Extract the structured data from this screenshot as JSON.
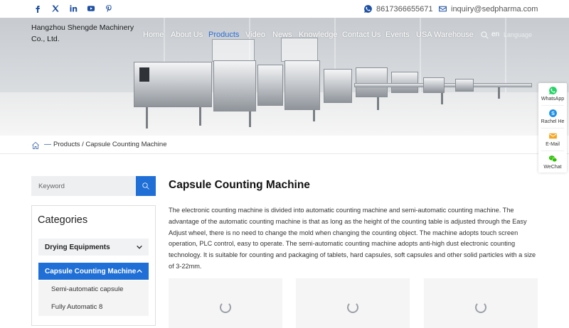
{
  "topbar": {
    "social_icons": [
      "facebook-icon",
      "x-twitter-icon",
      "linkedin-icon",
      "youtube-icon",
      "pinterest-icon"
    ],
    "phone": "8617366655671",
    "email": "inquiry@sedpharma.com"
  },
  "header": {
    "company_line1": "Hangzhou Shengde Machinery",
    "company_line2": "Co., Ltd.",
    "nav": [
      "Home",
      "About Us",
      "Products",
      "Video",
      "News",
      "Knowledge",
      "Contact Us",
      "Events",
      "USA Warehouse"
    ],
    "active_nav": "Products",
    "lang_code": "en",
    "lang_select": "Language"
  },
  "breadcrumb": {
    "separator": "—",
    "path": "Products / Capsule Counting Machine"
  },
  "sidebar": {
    "search_placeholder": "Keyword",
    "categories_title": "Categories",
    "items": [
      {
        "label": "Drying Equipments",
        "active": false
      },
      {
        "label": "Capsule Counting Machine",
        "active": true
      }
    ],
    "sub_items": [
      "Semi-automatic capsule",
      "Fully Automatic 8"
    ]
  },
  "main": {
    "title": "Capsule Counting Machine",
    "description": "The electronic counting machine is divided into automatic counting machine and semi-automatic counting machine. The advantage of the automatic counting machine is that as long as the height of the counting table is adjusted through the Easy Adjust wheel, there is no need to change the mold when changing the counting object. The machine adopts touch screen operation, PLC control, easy to operate. The semi-automatic counting machine adopts anti-high dust electronic counting technology. It is suitable for counting and packaging of tablets, hard capsules, soft capsules and other solid particles with a size of 3-22mm."
  },
  "side_contact": [
    {
      "label": "WhatsApp",
      "icon": "whatsapp-icon"
    },
    {
      "label": "Rachel He",
      "icon": "skype-icon"
    },
    {
      "label": "E-Mail",
      "icon": "email-icon"
    },
    {
      "label": "WeChat",
      "icon": "wechat-icon"
    }
  ],
  "colors": {
    "accent": "#1f6fd6",
    "icon_blue": "#1d4fa3",
    "whatsapp": "#25d366",
    "skype": "#1e90e6",
    "email": "#f5a623",
    "wechat": "#2dc100"
  }
}
